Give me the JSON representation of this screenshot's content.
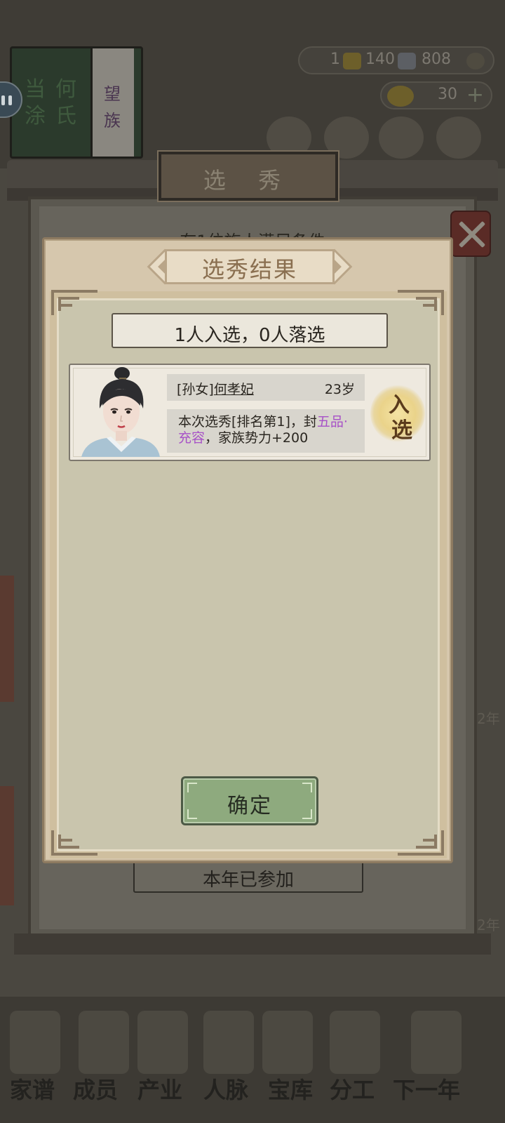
{
  "background": {
    "book": {
      "title_left": "当涂",
      "title_right": "何氏",
      "spine": "望族"
    },
    "resources": {
      "res1": "1",
      "res2": "140",
      "res3": "808"
    },
    "gold": "30",
    "panel_title": "选 秀",
    "info_text": "有1位族人满足条件",
    "joined_button": "本年已参加",
    "side_numbers": [
      "2年",
      "2年"
    ],
    "nav": [
      "家谱",
      "成员",
      "产业",
      "人脉",
      "宝库",
      "分工",
      "下一年"
    ]
  },
  "dialog": {
    "title": "选秀结果",
    "summary": "1人入选，0人落选",
    "result": {
      "relation": "[孙女]",
      "name": "何孝妃",
      "age": "23岁",
      "desc_prefix": "本次选秀[排名第1]，封",
      "rank": "五品·充容",
      "desc_suffix": "，家族势力+200",
      "seal_top": "入",
      "seal_bottom": "选"
    },
    "confirm": "确定"
  },
  "colors": {
    "dialog_bg": "#d6c7ad",
    "rank_purple": "#a751c7",
    "confirm_green": "#8eaa7e"
  }
}
